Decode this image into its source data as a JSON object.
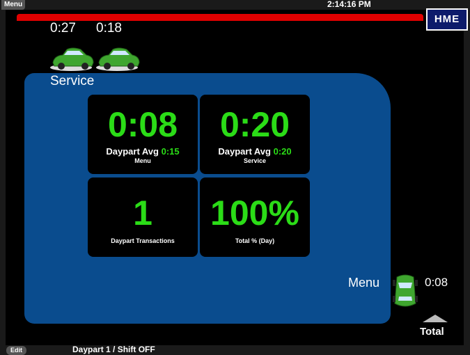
{
  "top": {
    "menu_tab": "Menu",
    "clock": "2:14:16 PM",
    "logo": "HME"
  },
  "queue": {
    "timers": [
      "0:27",
      "0:18"
    ],
    "car_icon": "car-icon"
  },
  "service_panel": {
    "title": "Service",
    "tiles": [
      {
        "value": "0:08",
        "label": "Daypart Avg",
        "avg": "0:15",
        "sublabel": "Menu"
      },
      {
        "value": "0:20",
        "label": "Daypart Avg",
        "avg": "0:20",
        "sublabel": "Service"
      },
      {
        "value": "1",
        "label": "Daypart Transactions"
      },
      {
        "value": "100%",
        "label": "Total % (Day)"
      }
    ]
  },
  "lane": {
    "label": "Menu",
    "time": "0:08"
  },
  "total": {
    "label": "Total"
  },
  "footer": {
    "edit": "Edit",
    "status": "Daypart 1 / Shift OFF"
  },
  "colors": {
    "accent_green": "#2bdc17",
    "panel_blue": "#0a4c8e",
    "alert_red": "#e00000",
    "logo_bg": "#0d1b6b"
  }
}
